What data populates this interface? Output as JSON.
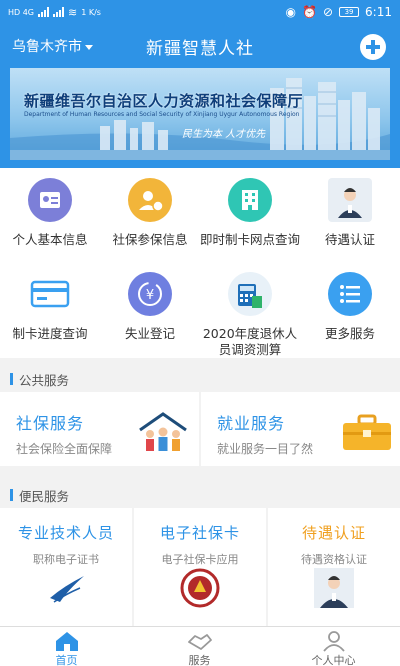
{
  "status_bar": {
    "left": "HD 4G",
    "speed": "1 K/s",
    "battery": "39",
    "time": "6:11"
  },
  "header": {
    "city": "乌鲁木齐市",
    "title": "新疆智慧人社",
    "add_icon": "plus-circle-icon"
  },
  "banner": {
    "title": "新疆维吾尔自治区人力资源和社会保障厅",
    "subtitle": "Department of Human Resources and Social Security of Xinjiang Uygur Autonomous Region",
    "slogan": "民生为本  人才优先"
  },
  "grid": [
    {
      "label": "个人基本信息",
      "icon": "id-card-icon",
      "color": "#7c7fd8"
    },
    {
      "label": "社保参保信息",
      "icon": "person-badge-icon",
      "color": "#f2b53a"
    },
    {
      "label": "即时制卡网点查询",
      "icon": "building-icon",
      "color": "#2fc6b4"
    },
    {
      "label": "待遇认证",
      "icon": "face-photo-icon",
      "color": "#e8eef4"
    },
    {
      "label": "制卡进度查询",
      "icon": "card-icon",
      "color": "#3aa0f0"
    },
    {
      "label": "失业登记",
      "icon": "yen-refresh-icon",
      "color": "#6f7fe0"
    },
    {
      "label": "2020年度退休人员调资测算",
      "icon": "calculator-icon",
      "color": "#e8f1f8"
    },
    {
      "label": "更多服务",
      "icon": "list-icon",
      "color": "#3aa0f0"
    }
  ],
  "sections": {
    "public": "公共服务",
    "convenience": "便民服务"
  },
  "public_services": [
    {
      "title": "社保服务",
      "subtitle": "社会保险全面保障",
      "icon": "family-house-icon"
    },
    {
      "title": "就业服务",
      "subtitle": "就业服务一目了然",
      "icon": "briefcase-icon"
    }
  ],
  "convenience_services": [
    {
      "title": "专业技术人员",
      "subtitle": "职称电子证书",
      "icon": "swoosh-logo-icon"
    },
    {
      "title": "电子社保卡",
      "subtitle": "电子社保卡应用",
      "icon": "social-security-seal-icon"
    },
    {
      "title": "待遇认证",
      "subtitle": "待遇资格认证",
      "icon": "face-photo-icon"
    }
  ],
  "tabs": [
    {
      "label": "首页",
      "icon": "home-icon",
      "active": true
    },
    {
      "label": "服务",
      "icon": "handshake-icon",
      "active": false
    },
    {
      "label": "个人中心",
      "icon": "user-icon",
      "active": false
    }
  ]
}
